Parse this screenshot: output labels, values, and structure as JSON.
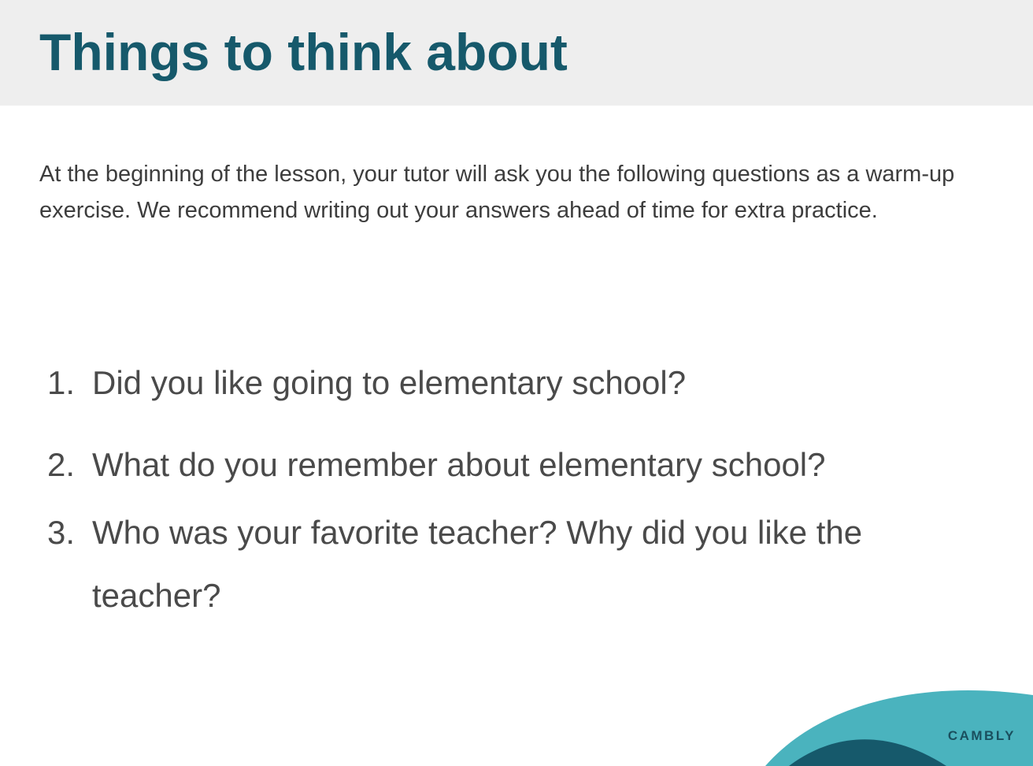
{
  "slide": {
    "title": "Things to think about",
    "intro": "At the beginning of the lesson, your tutor will ask you the following questions as a warm-up exercise. We recommend writing out your answers ahead of time for extra practice.",
    "questions": [
      {
        "number": "1.",
        "text": "Did you like going to elementary school?"
      },
      {
        "number": "2.",
        "text": "What do you remember about elementary school?"
      },
      {
        "number": "3.",
        "text": "Who was your favorite teacher? Why did you like the teacher?"
      }
    ],
    "brand": "CAMBLY"
  },
  "colors": {
    "title": "#16596b",
    "header_background": "#eeeeee",
    "body_text": "#3d3d3d",
    "accent_light": "#4ab3be",
    "accent_dark": "#16596b"
  }
}
